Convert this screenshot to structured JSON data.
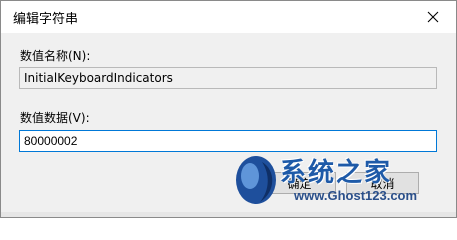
{
  "dialog": {
    "title": "编辑字符串",
    "close_glyph": "✕"
  },
  "fields": {
    "name_label": "数值名称(N):",
    "name_value": "InitialKeyboardIndicators",
    "data_label": "数值数据(V):",
    "data_value": "80000002"
  },
  "buttons": {
    "ok_label": "确定",
    "cancel_label": "取消"
  },
  "watermark": {
    "brand": "系统之家",
    "url": "www.Ghost123.com"
  },
  "colors": {
    "focus_border": "#0078d7",
    "dialog_bg": "#f0f0f0",
    "watermark_blue": "#1e5aa8"
  }
}
